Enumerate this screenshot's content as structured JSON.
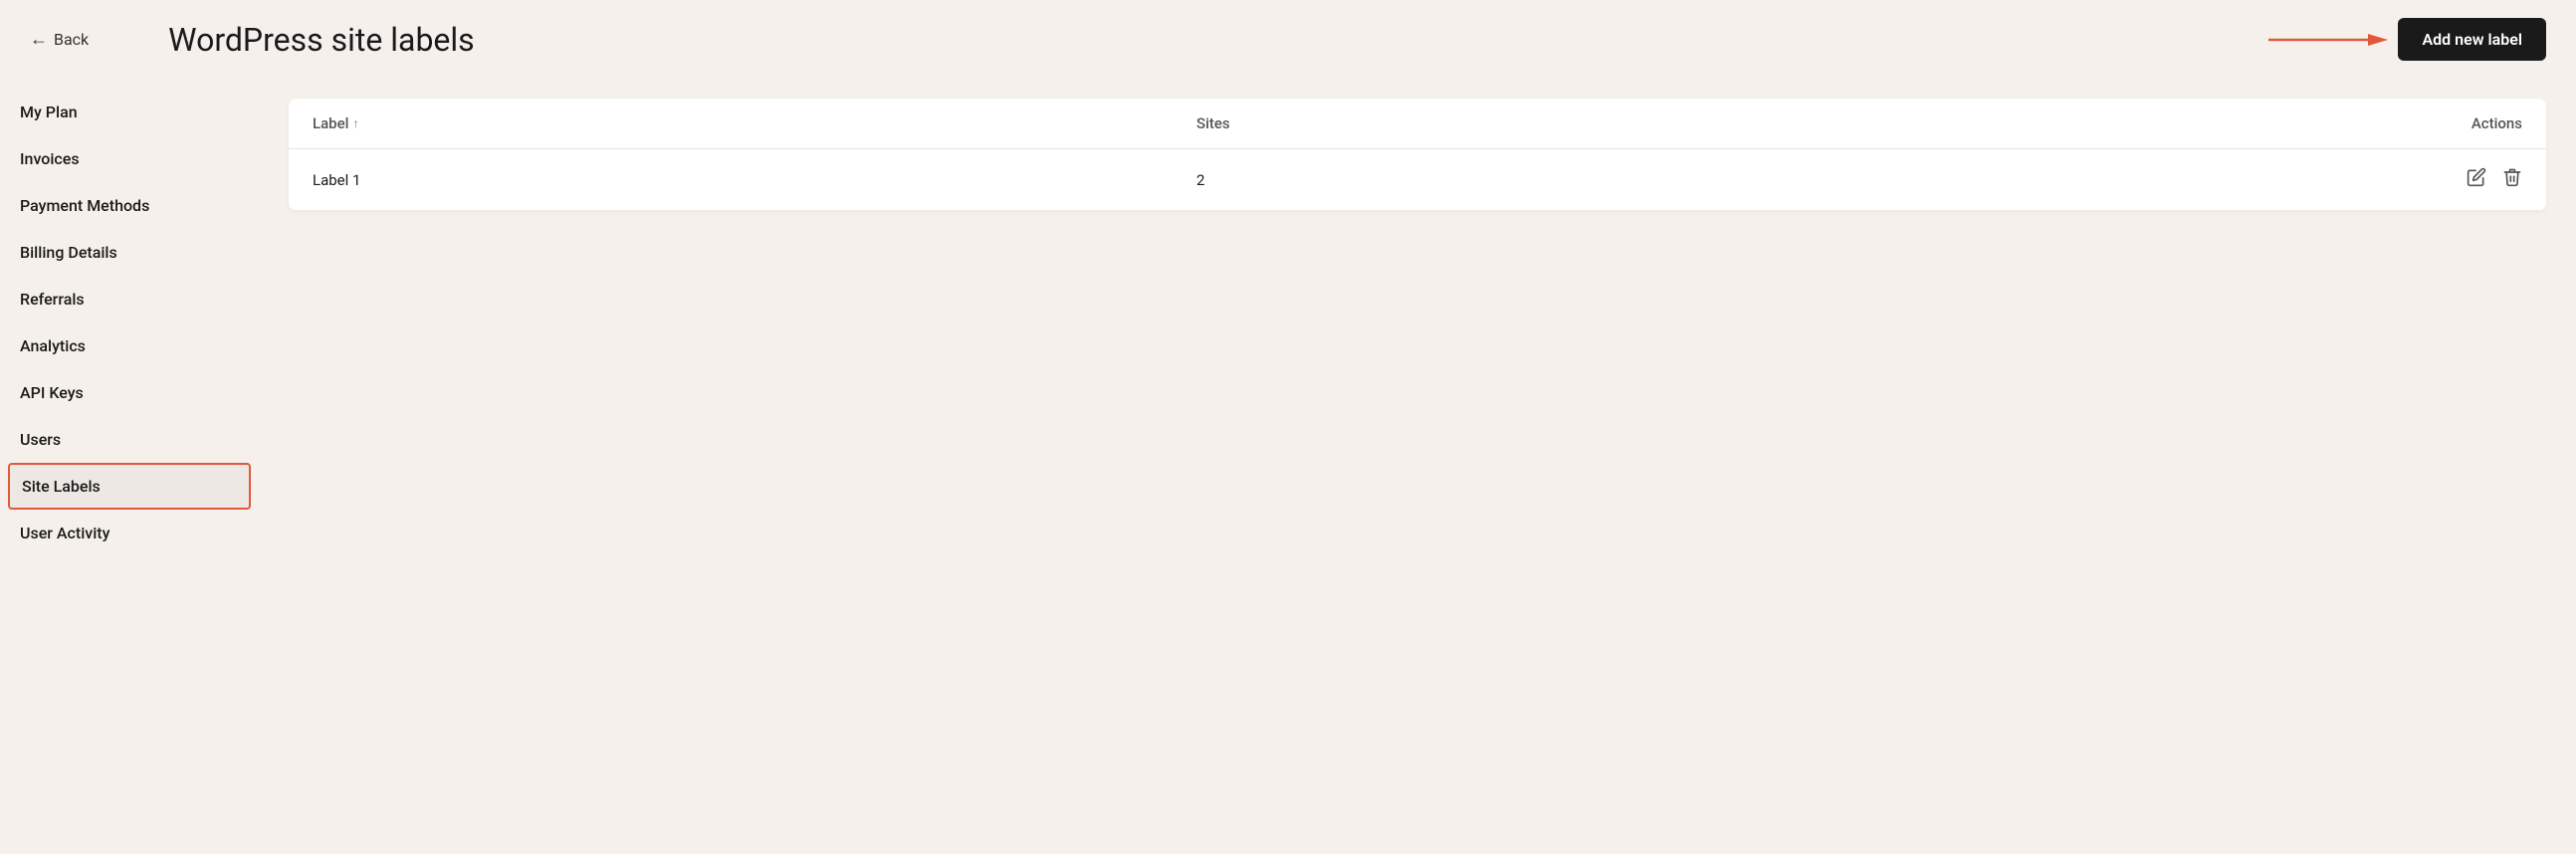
{
  "header": {
    "back_label": "Back",
    "page_title": "WordPress site labels",
    "add_button_label": "Add new label"
  },
  "sidebar": {
    "items": [
      {
        "id": "my-plan",
        "label": "My Plan",
        "active": false
      },
      {
        "id": "invoices",
        "label": "Invoices",
        "active": false
      },
      {
        "id": "payment-methods",
        "label": "Payment Methods",
        "active": false
      },
      {
        "id": "billing-details",
        "label": "Billing Details",
        "active": false
      },
      {
        "id": "referrals",
        "label": "Referrals",
        "active": false
      },
      {
        "id": "analytics",
        "label": "Analytics",
        "active": false
      },
      {
        "id": "api-keys",
        "label": "API Keys",
        "active": false
      },
      {
        "id": "users",
        "label": "Users",
        "active": false
      },
      {
        "id": "site-labels",
        "label": "Site Labels",
        "active": true
      },
      {
        "id": "user-activity",
        "label": "User Activity",
        "active": false
      }
    ]
  },
  "table": {
    "columns": {
      "label": "Label",
      "sites": "Sites",
      "actions": "Actions"
    },
    "rows": [
      {
        "label": "Label 1",
        "sites": "2"
      }
    ]
  },
  "icons": {
    "back_arrow": "←",
    "sort_up": "↑",
    "edit": "✎",
    "delete": "🗑"
  }
}
